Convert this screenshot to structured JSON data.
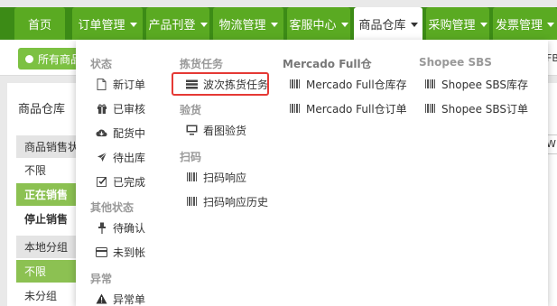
{
  "nav": {
    "tabs": [
      {
        "label": "首页",
        "caret": false
      },
      {
        "label": "订单管理",
        "caret": true
      },
      {
        "label": "产品刊登",
        "caret": true
      },
      {
        "label": "物流管理",
        "caret": true
      },
      {
        "label": "客服中心",
        "caret": true
      },
      {
        "label": "商品仓库",
        "caret": true,
        "active": true
      },
      {
        "label": "采购管理",
        "caret": true
      },
      {
        "label": "发票管理",
        "caret": true
      }
    ]
  },
  "subbar": {
    "all_products": "所有商品",
    "right_text": "FB"
  },
  "panel": {
    "title": "商品仓库",
    "filters": [
      {
        "label": "商品销售状",
        "style": "header"
      },
      {
        "label": "不限",
        "style": "plain"
      },
      {
        "label": "正在销售",
        "style": "green"
      },
      {
        "label": "停止销售",
        "style": "bold"
      },
      {
        "label": "本地分组",
        "style": "header"
      },
      {
        "label": "不限",
        "style": "green"
      },
      {
        "label": "未分组",
        "style": "plain"
      }
    ],
    "right_stub": "W"
  },
  "menu": {
    "col1": {
      "status_title": "状态",
      "status_items": [
        {
          "label": "新订单",
          "icon": "file-icon"
        },
        {
          "label": "已审核",
          "icon": "gift-icon"
        },
        {
          "label": "配货中",
          "icon": "cloud-download-icon"
        },
        {
          "label": "待出库",
          "icon": "plane-icon"
        },
        {
          "label": "已完成",
          "icon": "check-square-icon"
        }
      ],
      "other_title": "其他状态",
      "other_items": [
        {
          "label": "待确认",
          "icon": "pin-icon"
        },
        {
          "label": "未到帐",
          "icon": "credit-card-icon"
        }
      ],
      "abnormal_title": "异常",
      "abnormal_items": [
        {
          "label": "异常单",
          "icon": "warning-icon"
        }
      ]
    },
    "col2": {
      "picking_title": "拣货任务",
      "picking_items": [
        {
          "label": "波次拣货任务",
          "icon": "tasks-icon"
        }
      ],
      "inspection_title": "验货",
      "inspection_items": [
        {
          "label": "看图验货",
          "icon": "monitor-icon"
        }
      ],
      "scan_title": "扫码",
      "scan_items": [
        {
          "label": "扫码响应",
          "icon": "barcode-icon"
        },
        {
          "label": "扫码响应历史",
          "icon": "barcode-icon"
        }
      ]
    },
    "col3": {
      "title": "Mercado Full仓",
      "items": [
        {
          "label": "Mercado Full仓库存",
          "icon": "barcode-icon"
        },
        {
          "label": "Mercado Full仓订单",
          "icon": "barcode-icon"
        }
      ]
    },
    "col4": {
      "title": "Shopee SBS",
      "items": [
        {
          "label": "Shopee SBS库存",
          "icon": "barcode-icon"
        },
        {
          "label": "Shopee SBS订单",
          "icon": "barcode-icon"
        }
      ]
    }
  },
  "colors": {
    "nav_dark": "#3c8b16",
    "nav_tab": "#5aaa22",
    "green_filter": "#8cc152",
    "highlight": "#e53935"
  }
}
